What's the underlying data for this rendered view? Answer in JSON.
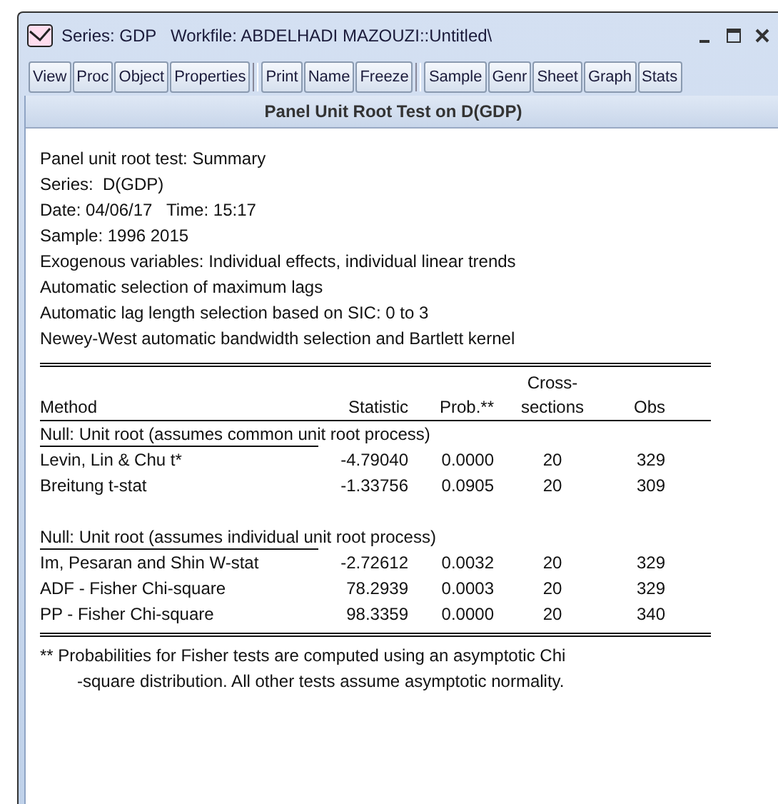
{
  "window": {
    "title": "Series: GDP   Workfile: ABDELHADI MAZOUZI::Untitled\\"
  },
  "toolbar": [
    [
      "View",
      "Proc",
      "Object",
      "Properties"
    ],
    [
      "Print",
      "Name",
      "Freeze"
    ],
    [
      "Sample",
      "Genr",
      "Sheet",
      "Graph",
      "Stats"
    ]
  ],
  "header": "Panel Unit Root Test on D(GDP)",
  "summary": [
    "Panel unit root test: Summary",
    "Series:  D(GDP)",
    "Date: 04/06/17   Time: 15:17",
    "Sample: 1996 2015",
    "Exogenous variables: Individual effects, individual linear trends",
    "Automatic selection of maximum lags",
    "Automatic lag length selection based on SIC: 0 to 3",
    "Newey-West automatic bandwidth selection and Bartlett kernel"
  ],
  "table": {
    "columns": [
      "Method",
      "Statistic",
      "Prob.**",
      "Cross-\nsections",
      "Obs"
    ],
    "sections": [
      {
        "title": "Null: Unit root (assumes common unit root process)",
        "rows": [
          [
            "Levin, Lin & Chu t*",
            "-4.79040",
            "0.0000",
            "20",
            "329"
          ],
          [
            "Breitung t-stat",
            "-1.33756",
            "0.0905",
            "20",
            "309"
          ]
        ]
      },
      {
        "title": "Null: Unit root (assumes individual unit root process)",
        "rows": [
          [
            "Im, Pesaran and Shin W-stat",
            "-2.72612",
            "0.0032",
            "20",
            "329"
          ],
          [
            "ADF - Fisher Chi-square",
            "78.2939",
            "0.0003",
            "20",
            "329"
          ],
          [
            "PP - Fisher Chi-square",
            "98.3359",
            "0.0000",
            "20",
            "340"
          ]
        ]
      }
    ]
  },
  "footnote": [
    "** Probabilities for Fisher tests are computed using an asymptotic Chi",
    "-square distribution. All other tests assume asymptotic normality."
  ]
}
